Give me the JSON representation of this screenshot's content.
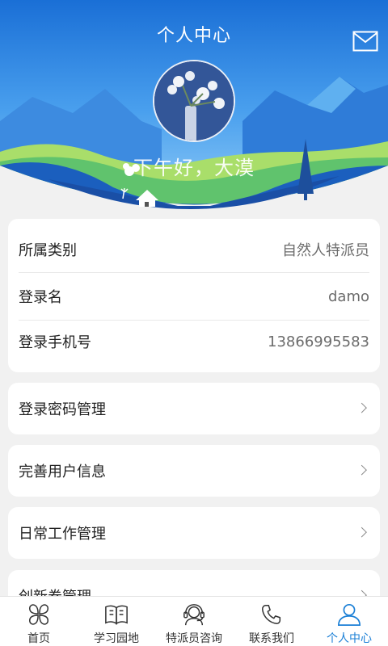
{
  "header": {
    "title": "个人中心",
    "greeting": "下午好，大漠"
  },
  "profile": {
    "rows": [
      {
        "label": "所属类别",
        "value": "自然人特派员"
      },
      {
        "label": "登录名",
        "value": "damo"
      },
      {
        "label": "登录手机号",
        "value": "13866995583"
      }
    ]
  },
  "menu": [
    {
      "label": "登录密码管理"
    },
    {
      "label": "完善用户信息"
    },
    {
      "label": "日常工作管理"
    },
    {
      "label": "创新券管理"
    }
  ],
  "tabs": [
    {
      "label": "首页",
      "icon": "clover-icon"
    },
    {
      "label": "学习园地",
      "icon": "book-icon"
    },
    {
      "label": "特派员咨询",
      "icon": "headset-icon"
    },
    {
      "label": "联系我们",
      "icon": "phone-icon"
    },
    {
      "label": "个人中心",
      "icon": "user-icon",
      "active": true
    }
  ],
  "colors": {
    "accent": "#1a7fd6",
    "sky": "#1f74d6",
    "background": "#f1f1f1"
  }
}
